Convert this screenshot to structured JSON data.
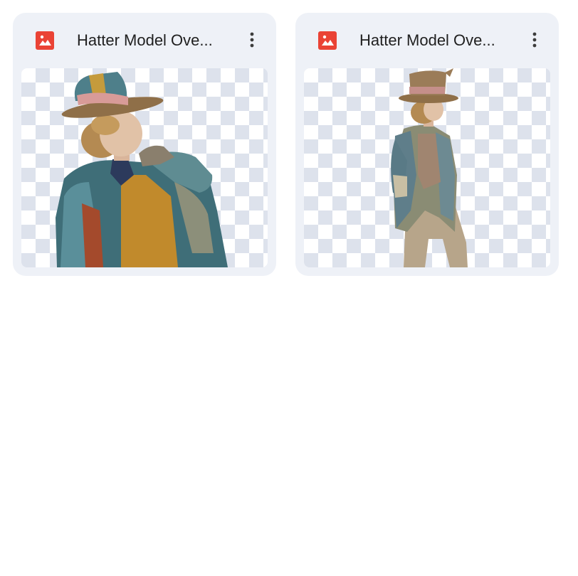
{
  "files": [
    {
      "name": "Hatter Model Ove...",
      "type_icon": "image-file-icon",
      "menu_icon": "more-vert-icon",
      "thumbnail": "hatter-sitting-figure"
    },
    {
      "name": "Hatter Model Ove...",
      "type_icon": "image-file-icon",
      "menu_icon": "more-vert-icon",
      "thumbnail": "hatter-standing-figure"
    }
  ],
  "colors": {
    "card_bg": "#eef1f7",
    "icon_red": "#ea4335",
    "text": "#1f1f1f",
    "checker": "#dde2ec"
  }
}
